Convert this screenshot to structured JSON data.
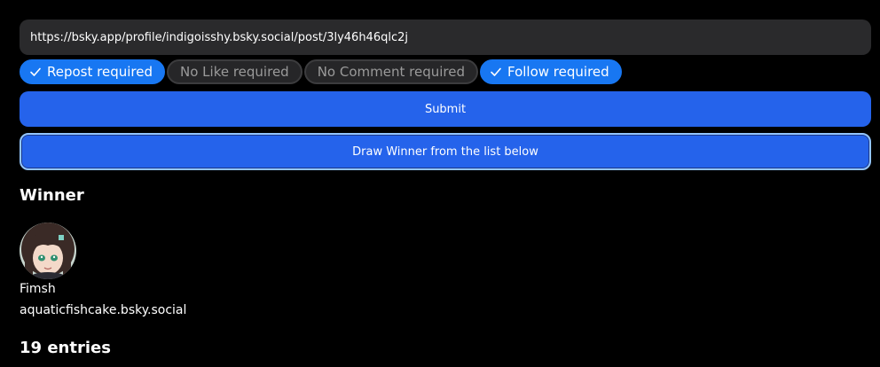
{
  "url_input": {
    "value": "https://bsky.app/profile/indigoisshy.bsky.social/post/3ly46h46qlc2j"
  },
  "requirements": [
    {
      "label": "Repost required",
      "active": true
    },
    {
      "label": "No Like required",
      "active": false
    },
    {
      "label": "No Comment required",
      "active": false
    },
    {
      "label": "Follow required",
      "active": true
    }
  ],
  "buttons": {
    "submit_label": "Submit",
    "draw_label": "Draw Winner from the list below"
  },
  "winner": {
    "heading": "Winner",
    "display_name": "Fimsh",
    "handle": "aquaticfishcake.bsky.social"
  },
  "entries": {
    "heading": "19 entries"
  },
  "colors": {
    "accent": "#2563eb",
    "chip_active": "#1877f2",
    "chip_inactive": "#262628",
    "input_bg": "#2a2a2c"
  },
  "icons": {
    "chip_active": "check-icon"
  }
}
